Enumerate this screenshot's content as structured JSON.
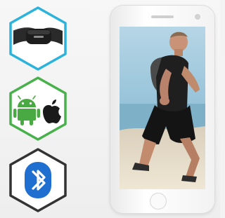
{
  "features": [
    {
      "name": "heart-rate-strap",
      "icon": "chest-strap-icon",
      "border_color": "#2bb3dc"
    },
    {
      "name": "platforms",
      "icons": [
        "android-icon",
        "apple-icon"
      ],
      "border_color": "#48b14b"
    },
    {
      "name": "connectivity",
      "icon": "bluetooth-icon",
      "border_color": "#333333"
    }
  ],
  "phone": {
    "screen_image": "runner-photo",
    "colors": {
      "sky": "#9fc6dc",
      "sea": "#7eb0c8",
      "sand": "#e6dcc8"
    }
  },
  "colors": {
    "android_green": "#49a942",
    "bluetooth_blue": "#1e6fd0",
    "strap_black": "#1d1d1d"
  }
}
